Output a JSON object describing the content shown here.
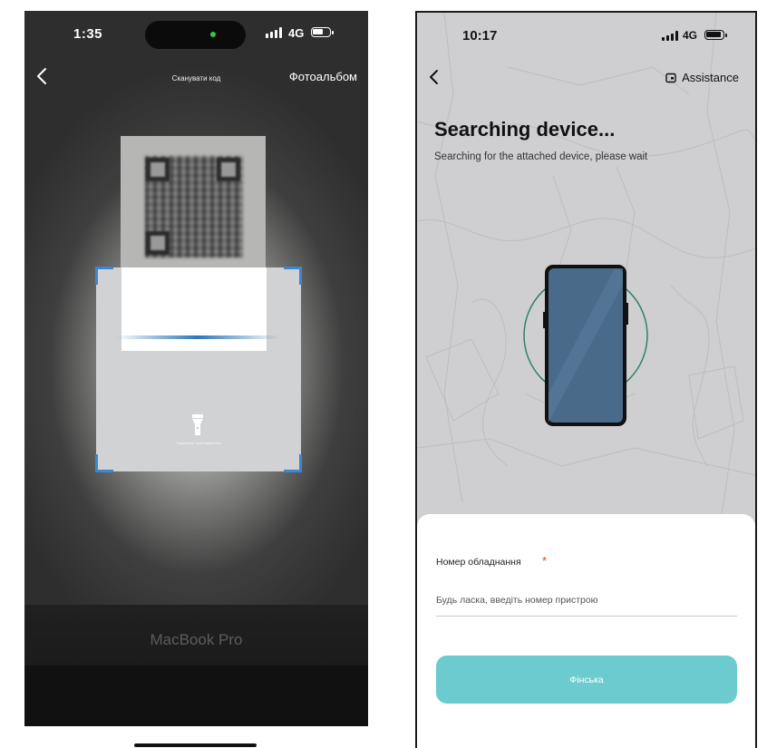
{
  "left_screen": {
    "status_bar": {
      "time": "1:35",
      "network": "4G"
    },
    "nav": {
      "title": "Сканувати код",
      "album_label": "Фотоальбом"
    },
    "scanner": {
      "torch_hint": "Торкніться, щоб підсвітити"
    },
    "background_label": "MacBook Pro"
  },
  "right_screen": {
    "status_bar": {
      "time": "10:17",
      "network": "4G"
    },
    "nav": {
      "assistance_label": "Assistance"
    },
    "heading": "Searching device...",
    "subtitle": "Searching for the attached device, please wait",
    "form": {
      "device_number_label": "Номер обладнання",
      "required_mark": "*",
      "device_number_placeholder": "Будь ласка, введіть номер пристрою",
      "device_number_value": "",
      "submit_label": "Фінська"
    }
  },
  "colors": {
    "scan_corner": "#3d86d0",
    "scan_line": "#2f77b9",
    "submit_button": "#6ccbce",
    "required_star": "#e53d2f",
    "device_ring": "#2f7f6e",
    "device_screen": "#4a6a8a"
  },
  "icons": [
    "back-arrow-icon",
    "flashlight-icon",
    "assistance-icon",
    "signal-icon",
    "battery-icon"
  ]
}
